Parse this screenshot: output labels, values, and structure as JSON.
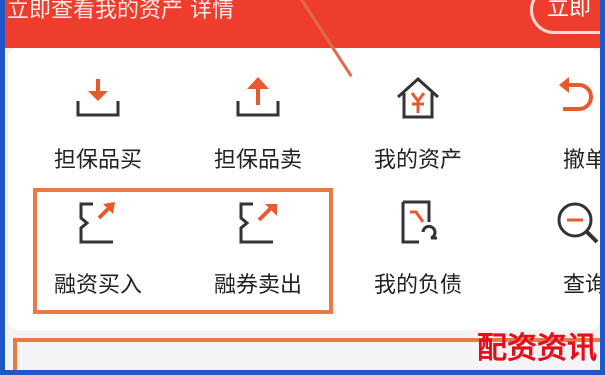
{
  "banner": {
    "text": "立即查看我的资产 详情",
    "button_label": "立即"
  },
  "row1": [
    {
      "label": "担保品买",
      "icon": "tray-download-icon"
    },
    {
      "label": "担保品卖",
      "icon": "tray-upload-icon"
    },
    {
      "label": "我的资产",
      "icon": "house-yuan-icon"
    },
    {
      "label": "撤单",
      "icon": "undo-arrow-icon"
    }
  ],
  "row2": [
    {
      "label": "融资买入",
      "icon": "bracket-arrow-icon"
    },
    {
      "label": "融券卖出",
      "icon": "bracket-arrow-out-icon"
    },
    {
      "label": "我的负债",
      "icon": "document-return-icon"
    },
    {
      "label": "查询",
      "icon": "search-icon"
    }
  ],
  "watermark": "配资资讯",
  "colors": {
    "accent": "#ef3d2d",
    "highlight": "#e97a45",
    "watermark": "#e3101b"
  }
}
